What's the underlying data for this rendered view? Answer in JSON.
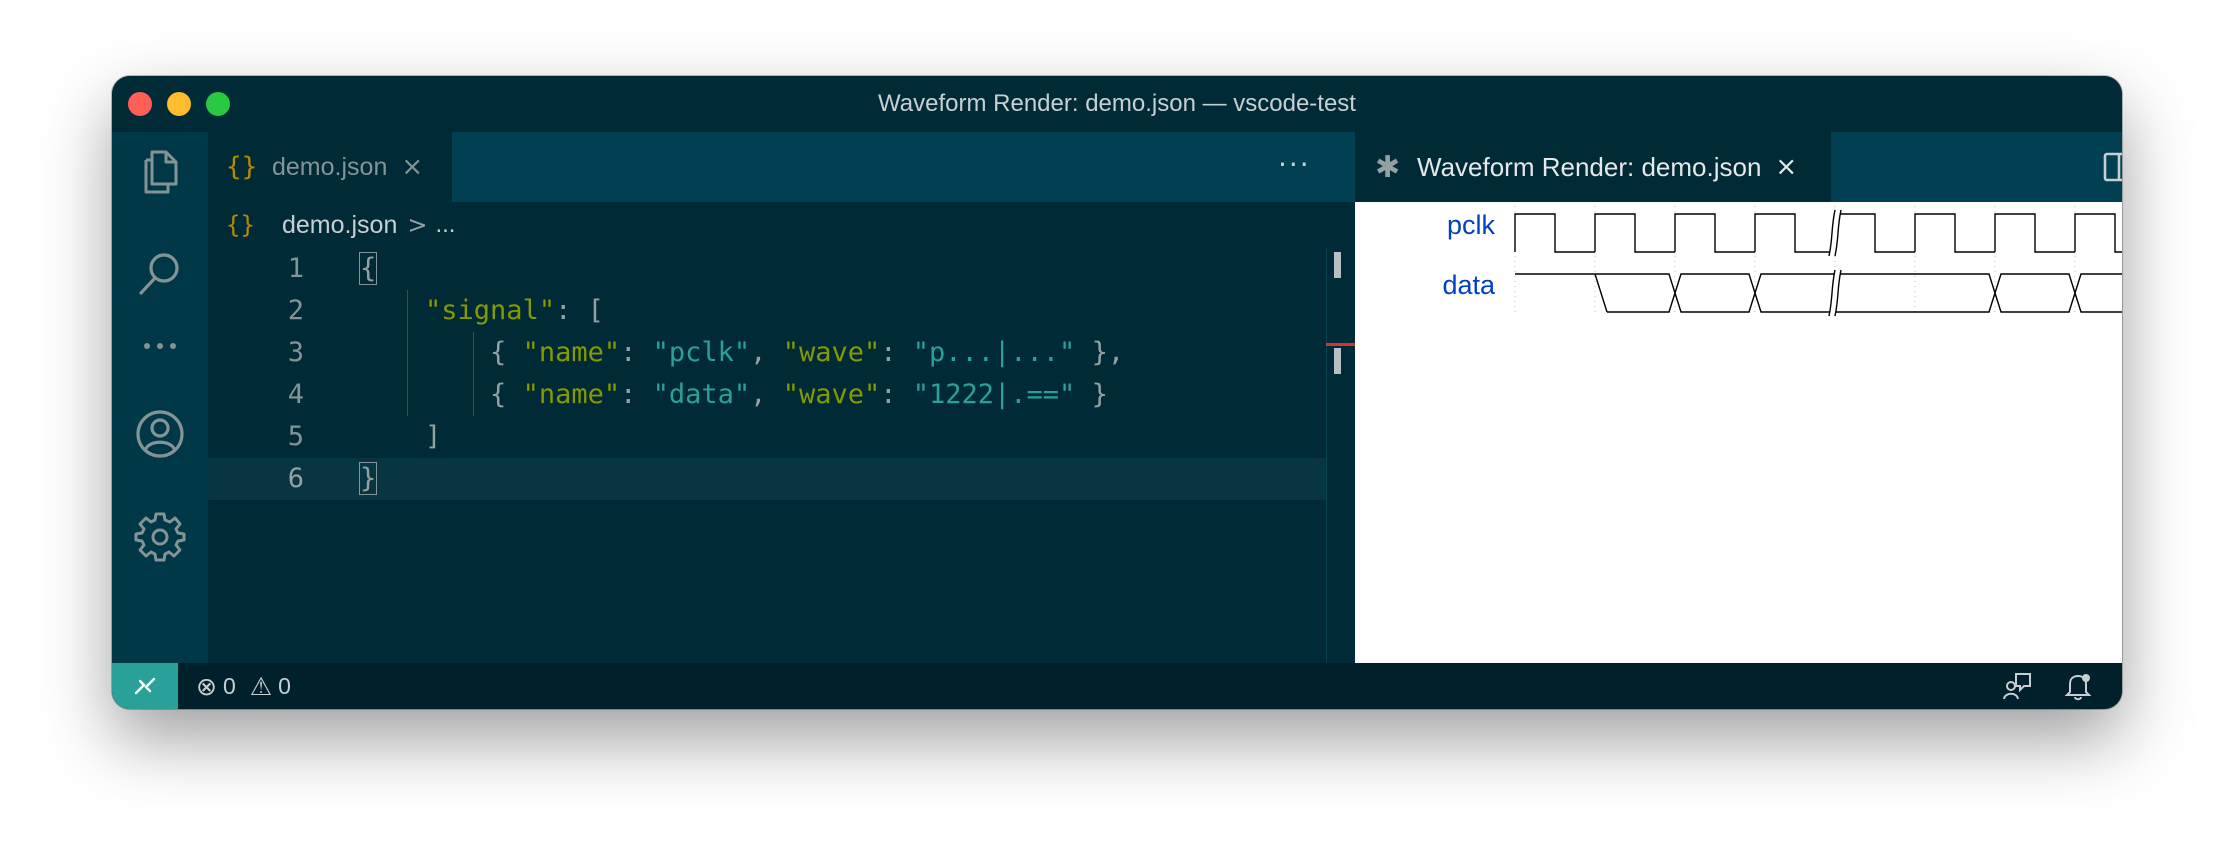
{
  "window": {
    "title": "Waveform Render: demo.json — vscode-test"
  },
  "activity_bar": {
    "items": [
      {
        "name": "explorer",
        "icon": "files-icon"
      },
      {
        "name": "search",
        "icon": "search-icon"
      },
      {
        "name": "more",
        "icon": "ellipsis-icon"
      },
      {
        "name": "accounts",
        "icon": "account-icon"
      },
      {
        "name": "manage",
        "icon": "gear-icon"
      }
    ]
  },
  "left_group": {
    "tab": {
      "label": "demo.json",
      "icon": "{}",
      "close": "×"
    },
    "more": "···",
    "breadcrumb": {
      "icon": "{}",
      "file": "demo.json",
      "separator": ">",
      "more": "..."
    },
    "lines": [
      {
        "num": "1",
        "tokens": [
          {
            "t": "{",
            "c": "p",
            "box": true
          }
        ]
      },
      {
        "num": "2",
        "tokens": [
          {
            "t": "    "
          },
          {
            "t": "\"signal\"",
            "c": "k"
          },
          {
            "t": ": [",
            "c": "p"
          }
        ]
      },
      {
        "num": "3",
        "tokens": [
          {
            "t": "        { ",
            "c": "p"
          },
          {
            "t": "\"name\"",
            "c": "k"
          },
          {
            "t": ": ",
            "c": "p"
          },
          {
            "t": "\"pclk\"",
            "c": "s"
          },
          {
            "t": ", ",
            "c": "p"
          },
          {
            "t": "\"wave\"",
            "c": "k"
          },
          {
            "t": ": ",
            "c": "p"
          },
          {
            "t": "\"p...|...\"",
            "c": "s"
          },
          {
            "t": " },",
            "c": "p"
          }
        ]
      },
      {
        "num": "4",
        "tokens": [
          {
            "t": "        { ",
            "c": "p"
          },
          {
            "t": "\"name\"",
            "c": "k"
          },
          {
            "t": ": ",
            "c": "p"
          },
          {
            "t": "\"data\"",
            "c": "s"
          },
          {
            "t": ", ",
            "c": "p"
          },
          {
            "t": "\"wave\"",
            "c": "k"
          },
          {
            "t": ": ",
            "c": "p"
          },
          {
            "t": "\"1222|.==\"",
            "c": "s"
          },
          {
            "t": " }",
            "c": "p"
          }
        ]
      },
      {
        "num": "5",
        "tokens": [
          {
            "t": "    ]",
            "c": "p"
          }
        ]
      },
      {
        "num": "6",
        "tokens": [
          {
            "t": "}",
            "c": "p",
            "box": true
          }
        ],
        "current": true
      }
    ]
  },
  "right_group": {
    "tab": {
      "label": "Waveform Render: demo.json",
      "icon": "✱",
      "close": "×"
    },
    "more": "···",
    "signals": [
      {
        "name": "pclk",
        "wave": "p...|..."
      },
      {
        "name": "data",
        "wave": "1222|.=="
      }
    ]
  },
  "status_bar": {
    "remote_icon": "remote-icon",
    "errors": "0",
    "warnings": "0",
    "error_icon": "⊗",
    "warning_icon": "⚠"
  },
  "colors": {
    "background": "#002b36",
    "tab_bar": "#004052",
    "activity_bar": "#003847",
    "keyword": "#859900",
    "string": "#2aa198",
    "signal_name": "#0041c4",
    "remote": "#2aa198"
  }
}
